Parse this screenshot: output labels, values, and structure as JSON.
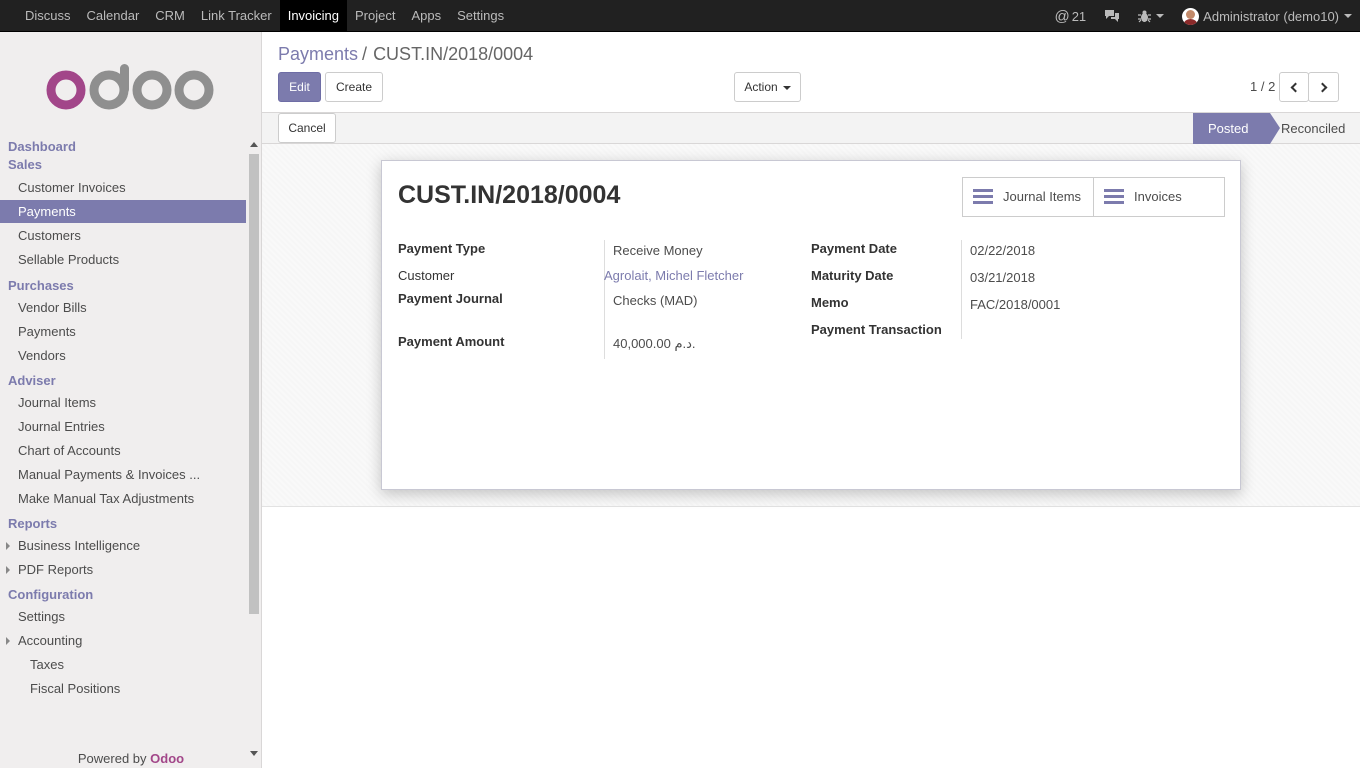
{
  "topnav": {
    "items": [
      "Discuss",
      "Calendar",
      "CRM",
      "Link Tracker",
      "Invoicing",
      "Project",
      "Apps",
      "Settings"
    ],
    "active": "Invoicing",
    "mentions_count": "21",
    "user": "Administrator (demo10)"
  },
  "sidebar": {
    "logo_text": "odoo",
    "dashboard": "Dashboard",
    "sections": [
      {
        "title": "Sales",
        "items": [
          "Customer Invoices",
          "Payments",
          "Customers",
          "Sellable Products"
        ]
      },
      {
        "title": "Purchases",
        "items": [
          "Vendor Bills",
          "Payments",
          "Vendors"
        ]
      },
      {
        "title": "Adviser",
        "items": [
          "Journal Items",
          "Journal Entries",
          "Chart of Accounts",
          "Manual Payments & Invoices ...",
          "Make Manual Tax Adjustments"
        ]
      },
      {
        "title": "Reports",
        "items": [
          "Business Intelligence",
          "PDF Reports"
        ]
      },
      {
        "title": "Configuration",
        "items": [
          "Settings",
          "Accounting",
          "Taxes",
          "Fiscal Positions"
        ]
      }
    ],
    "powered_by": "Powered by",
    "powered_brand": "Odoo"
  },
  "breadcrumb": {
    "parent": "Payments",
    "separator": "/",
    "current": "CUST.IN/2018/0004"
  },
  "buttons": {
    "edit": "Edit",
    "create": "Create",
    "action": "Action",
    "cancel": "Cancel"
  },
  "pager": {
    "value": "1 / 2"
  },
  "statusbar": {
    "stages": [
      "Posted",
      "Reconciled"
    ],
    "active": "Posted"
  },
  "form": {
    "title": "CUST.IN/2018/0004",
    "smart_buttons": [
      "Journal Items",
      "Invoices"
    ],
    "fields": {
      "payment_type": {
        "label": "Payment Type",
        "value": "Receive Money"
      },
      "customer": {
        "label": "Customer",
        "value": "Agrolait, Michel Fletcher"
      },
      "payment_journal": {
        "label": "Payment Journal",
        "value": "Checks (MAD)"
      },
      "payment_amount": {
        "label": "Payment Amount",
        "value": "40,000.00 د.م."
      },
      "payment_date": {
        "label": "Payment Date",
        "value": "02/22/2018"
      },
      "maturity_date": {
        "label": "Maturity Date",
        "value": "03/21/2018"
      },
      "memo": {
        "label": "Memo",
        "value": "FAC/2018/0001"
      },
      "payment_transaction": {
        "label": "Payment Transaction",
        "value": ""
      }
    }
  },
  "colors": {
    "accent": "#7c7bad",
    "brand": "#a24689",
    "topbar": "#212121"
  }
}
